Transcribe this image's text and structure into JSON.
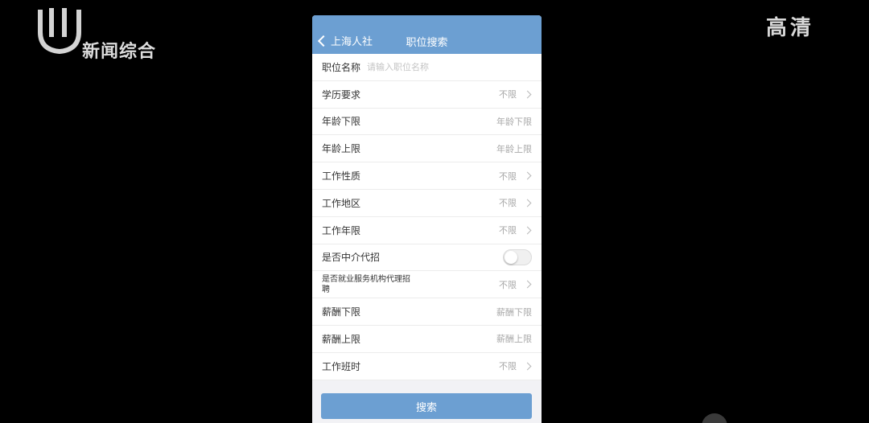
{
  "overlay": {
    "channel_name": "新闻综合",
    "hd_badge": "高清"
  },
  "nav": {
    "back_label": "上海人社",
    "title": "职位搜索"
  },
  "form": {
    "job_name": {
      "label": "职位名称",
      "placeholder": "请输入职位名称"
    },
    "rows": [
      {
        "label": "学历要求",
        "value": "不限"
      },
      {
        "label": "年龄下限",
        "value": "年龄下限"
      },
      {
        "label": "年龄上限",
        "value": "年龄上限"
      },
      {
        "label": "工作性质",
        "value": "不限"
      },
      {
        "label": "工作地区",
        "value": "不限"
      },
      {
        "label": "工作年限",
        "value": "不限"
      }
    ],
    "agency_toggle": {
      "label": "是否中介代招",
      "on": false
    },
    "agency_service": {
      "label": "是否就业服务机构代理招聘",
      "value": "不限"
    },
    "rows2": [
      {
        "label": "薪酬下限",
        "value": "薪酬下限"
      },
      {
        "label": "薪酬上限",
        "value": "薪酬上限"
      },
      {
        "label": "工作班时",
        "value": "不限"
      }
    ],
    "search_label": "搜索"
  },
  "colors": {
    "accent": "#6c9fd2",
    "background": "#000000"
  }
}
